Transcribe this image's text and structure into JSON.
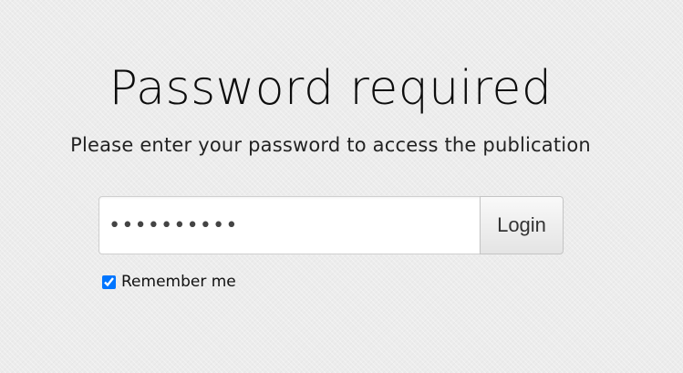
{
  "page": {
    "title": "Password required",
    "subtitle": "Please enter your password to access the publication"
  },
  "form": {
    "password_value": "••••••••••",
    "login_label": "Login",
    "remember_label": "Remember me",
    "remember_checked": true
  }
}
